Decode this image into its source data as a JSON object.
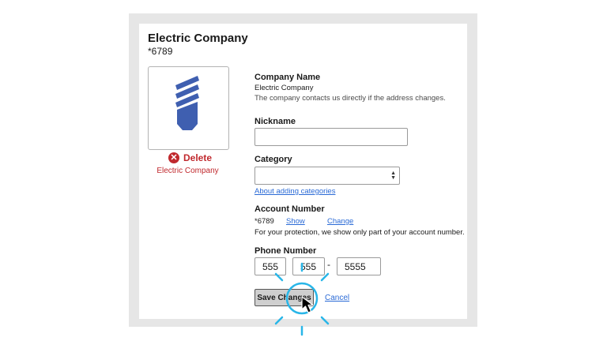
{
  "header": {
    "title": "Electric Company",
    "account_masked": "*6789"
  },
  "logo": {
    "icon": "lightbulb-plug-icon",
    "caption": "Electric Company",
    "delete_label": "Delete",
    "brand_color": "#3f5fb0"
  },
  "company_name": {
    "label": "Company Name",
    "value": "Electric Company",
    "note": "The company contacts us directly if the address changes."
  },
  "nickname": {
    "label": "Nickname",
    "value": ""
  },
  "category": {
    "label": "Category",
    "value": "",
    "help_link": "About adding categories"
  },
  "account_number": {
    "label": "Account Number",
    "value": "*6789",
    "show_link": "Show",
    "change_link": "Change",
    "note": "For your protection, we show only part of your account number."
  },
  "phone": {
    "label": "Phone Number",
    "area": "555",
    "prefix": "555",
    "separator": "-",
    "line": "5555"
  },
  "actions": {
    "save_label": "Save Changes",
    "cancel_label": "Cancel"
  },
  "colors": {
    "danger": "#c0282d",
    "link": "#2a6ad6",
    "click_highlight": "#29b6e8"
  }
}
